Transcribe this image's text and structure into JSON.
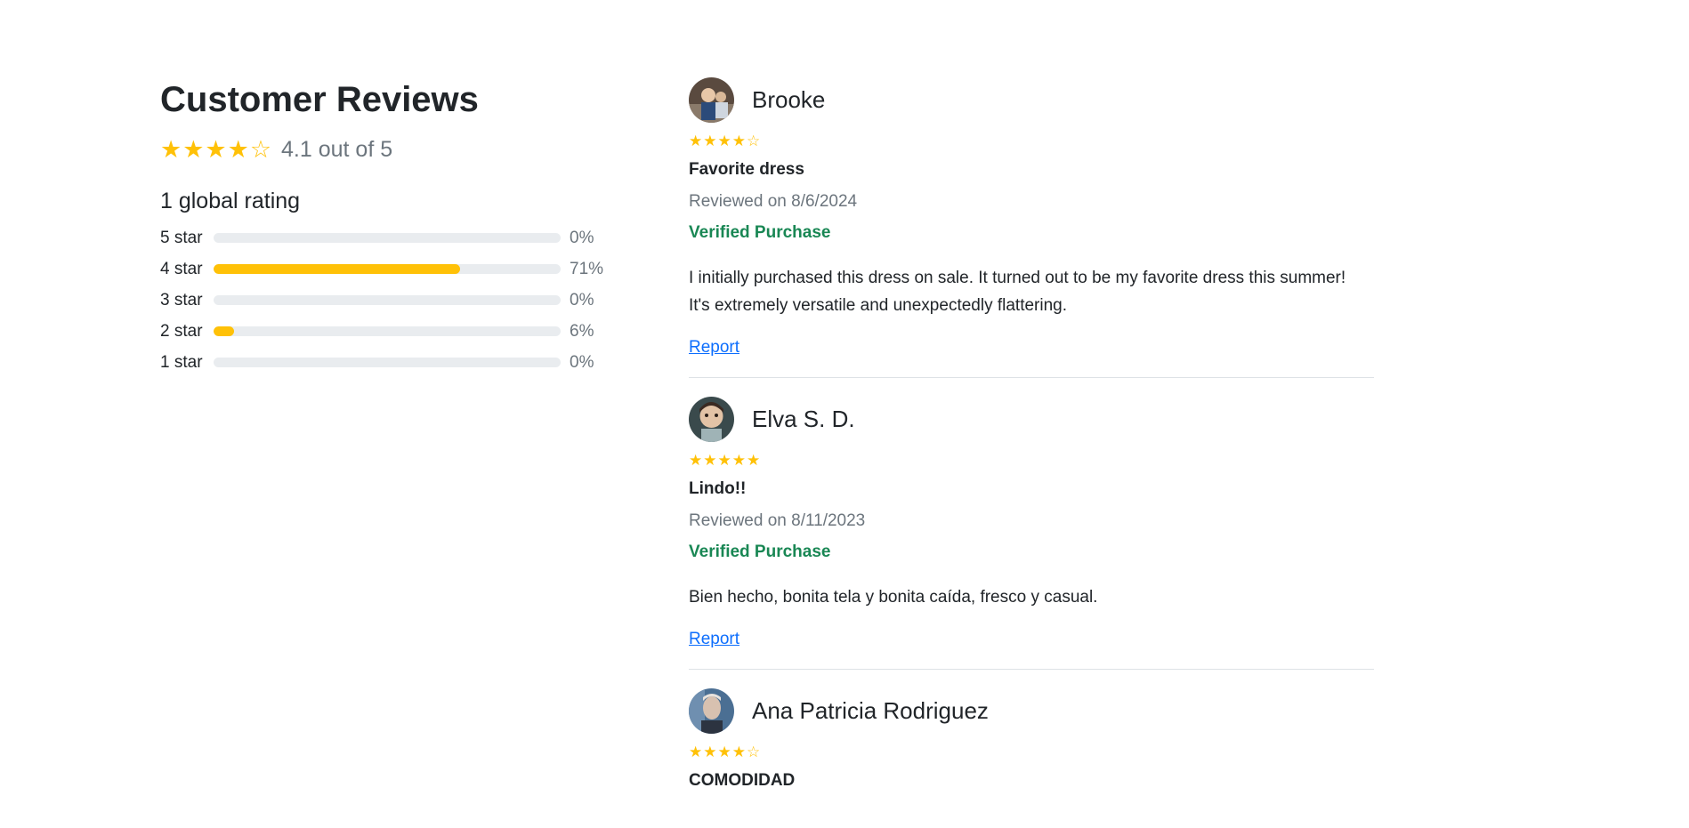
{
  "summary": {
    "title": "Customer Reviews",
    "stars": "★★★★☆",
    "average_text": "4.1 out of 5",
    "global_rating": "1 global rating",
    "histogram": [
      {
        "label": "5 star",
        "percent_text": "0%",
        "fraction": 0.0
      },
      {
        "label": "4 star",
        "percent_text": "71%",
        "fraction": 0.71
      },
      {
        "label": "3 star",
        "percent_text": "0%",
        "fraction": 0.0
      },
      {
        "label": "2 star",
        "percent_text": "6%",
        "fraction": 0.06
      },
      {
        "label": "1 star",
        "percent_text": "0%",
        "fraction": 0.0
      }
    ]
  },
  "reviews": [
    {
      "name": "Brooke",
      "stars": "★★★★☆",
      "title": "Favorite dress",
      "date": "Reviewed on 8/6/2024",
      "verified": "Verified Purchase",
      "body": "I initially purchased this dress on sale. It turned out to be my favorite dress this summer! It's extremely versatile and unexpectedly flattering.",
      "report": "Report"
    },
    {
      "name": "Elva S. D.",
      "stars": "★★★★★",
      "title": "Lindo!!",
      "date": "Reviewed on 8/11/2023",
      "verified": "Verified Purchase",
      "body": "Bien hecho, bonita tela y bonita caída, fresco y casual.",
      "report": "Report"
    },
    {
      "name": "Ana Patricia Rodriguez",
      "stars": "★★★★☆",
      "title": "COMODIDAD"
    }
  ],
  "colors": {
    "star": "#ffc107",
    "verified": "#198754",
    "link": "#0d6efd",
    "track": "#e9ecef"
  }
}
